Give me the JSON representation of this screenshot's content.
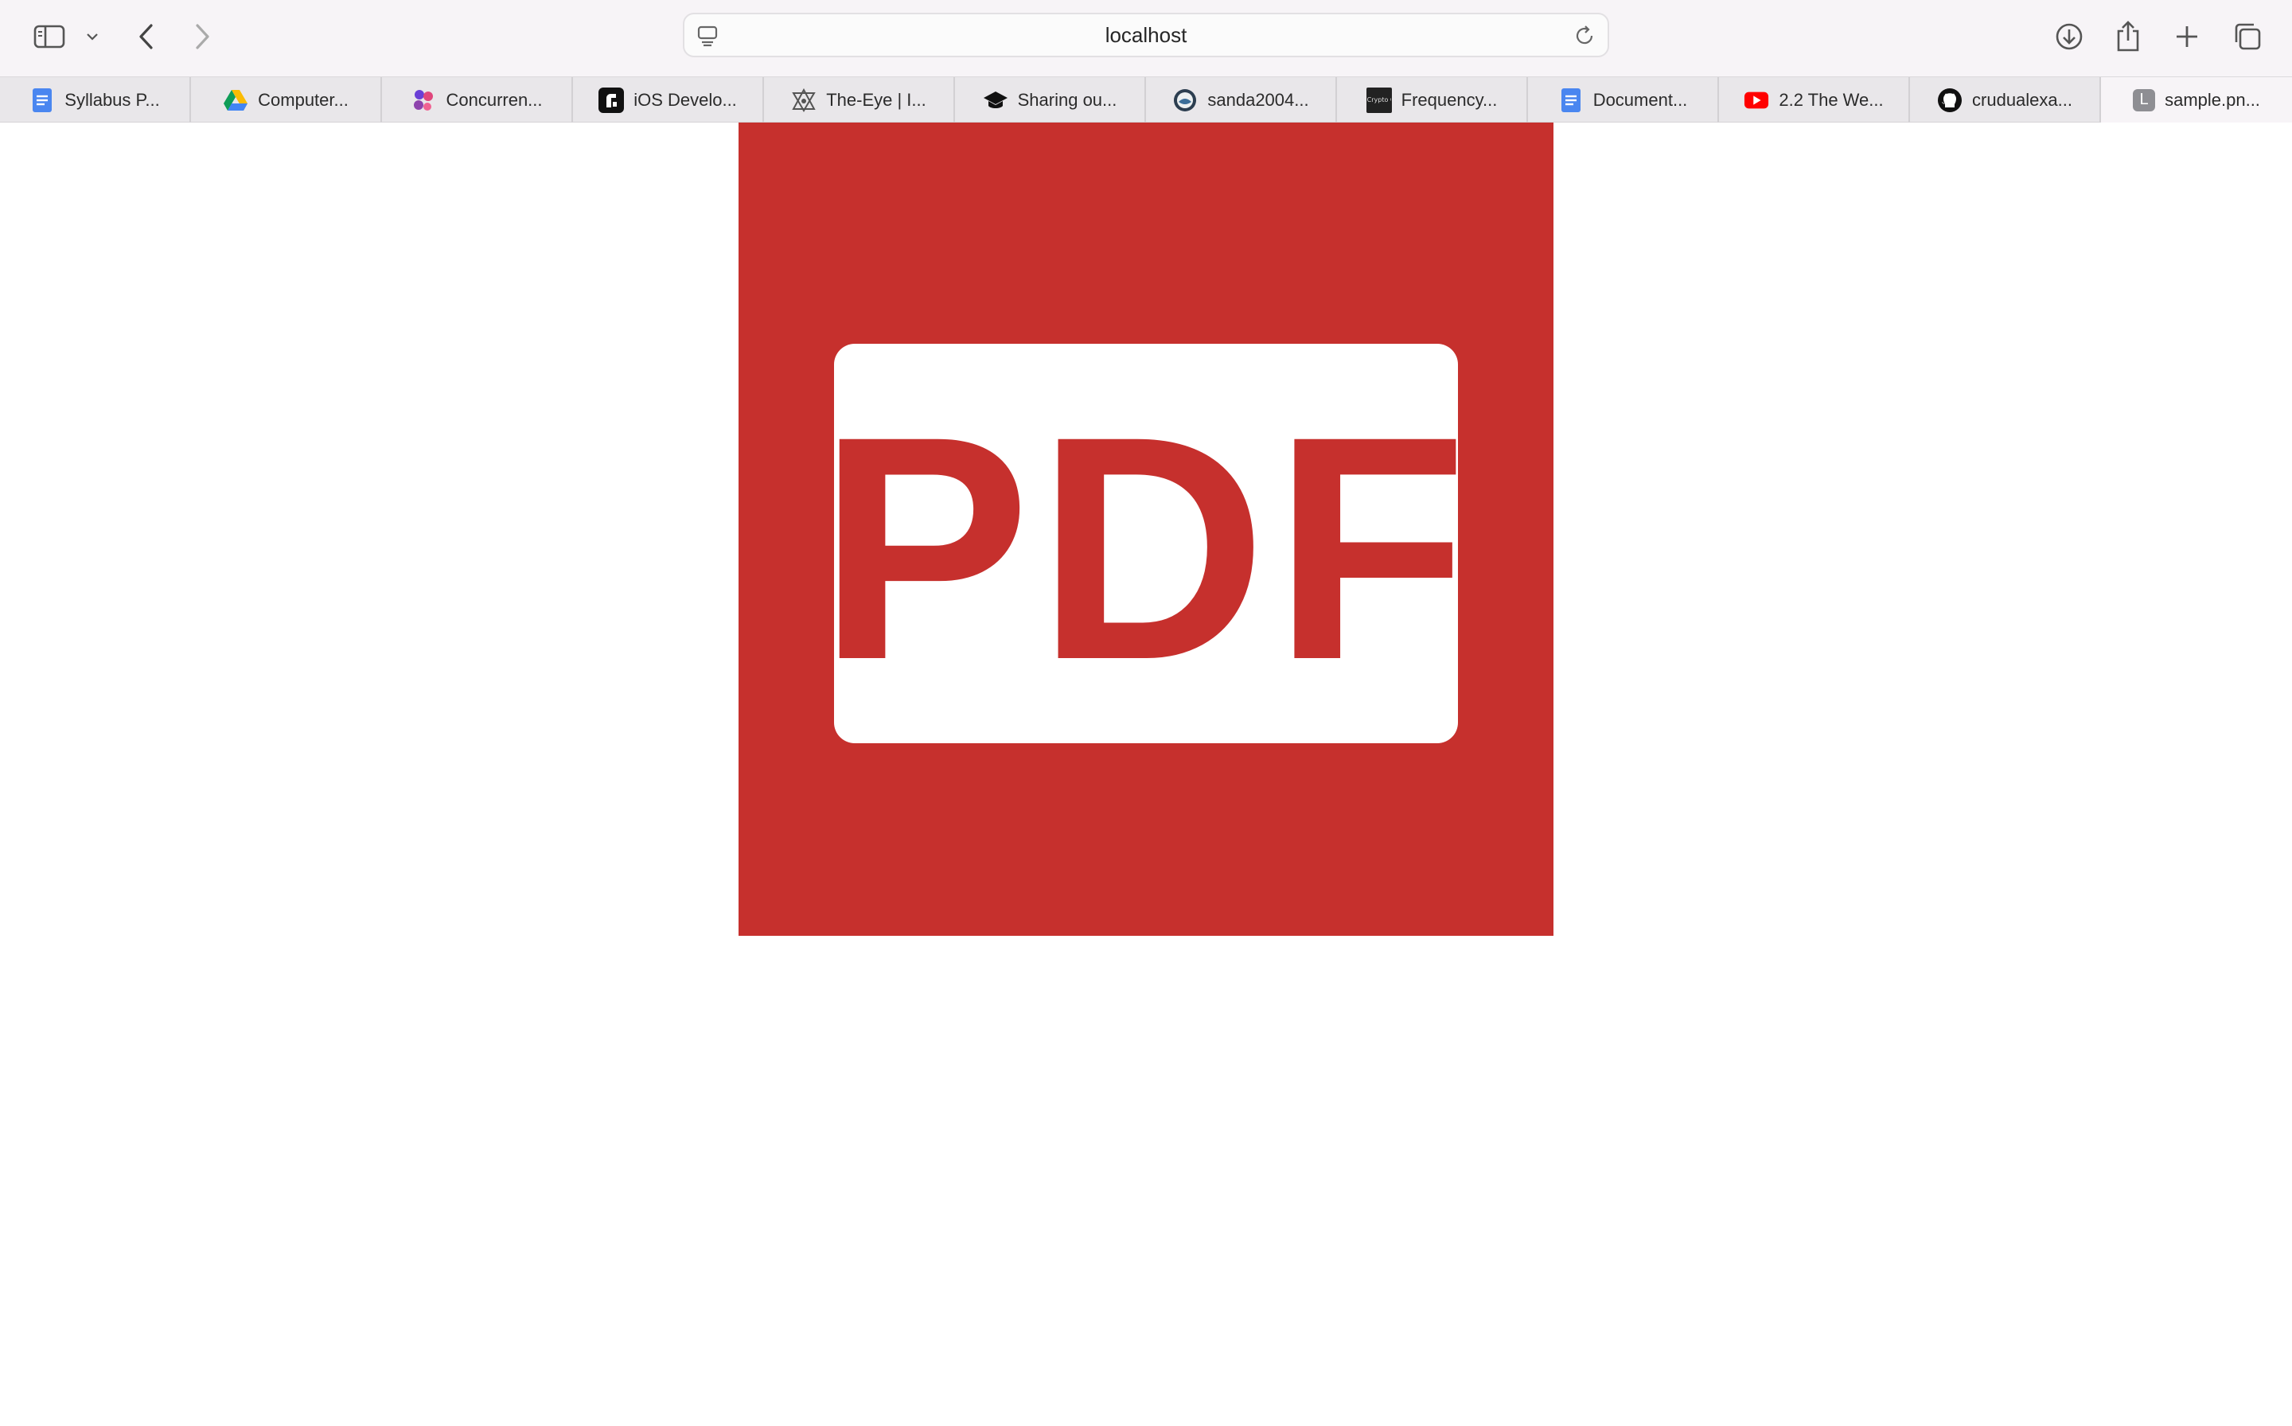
{
  "browser": {
    "address_bar": {
      "url": "localhost"
    },
    "toolbar": {
      "sidebar_icon": "sidebar-icon",
      "back_icon": "chevron-left-icon",
      "forward_icon": "chevron-right-icon",
      "download_icon": "download-icon",
      "share_icon": "share-icon",
      "new_tab_icon": "plus-icon",
      "tab_overview_icon": "tabs-overview-icon"
    },
    "tabs": [
      {
        "label": "Syllabus P...",
        "favicon": "google-docs-icon"
      },
      {
        "label": "Computer...",
        "favicon": "google-drive-icon"
      },
      {
        "label": "Concurren...",
        "favicon": "app-icon"
      },
      {
        "label": "iOS Develo...",
        "favicon": "app-icon"
      },
      {
        "label": "The-Eye | I...",
        "favicon": "eye-logo-icon"
      },
      {
        "label": "Sharing ou...",
        "favicon": "graduation-cap-icon"
      },
      {
        "label": "sanda2004...",
        "favicon": "globe-icon"
      },
      {
        "label": "Frequency...",
        "favicon": "site-icon",
        "favicon_text": "Crypto Corner"
      },
      {
        "label": "Document...",
        "favicon": "google-docs-icon"
      },
      {
        "label": "2.2 The We...",
        "favicon": "youtube-icon"
      },
      {
        "label": "crudualexa...",
        "favicon": "github-icon"
      },
      {
        "label": "sample.pn...",
        "favicon": "letter-icon",
        "favicon_letter": "L",
        "active": true
      }
    ]
  },
  "content": {
    "image_text": "PDF",
    "colors": {
      "brand_red": "#c6302d",
      "card_white": "#ffffff"
    }
  }
}
